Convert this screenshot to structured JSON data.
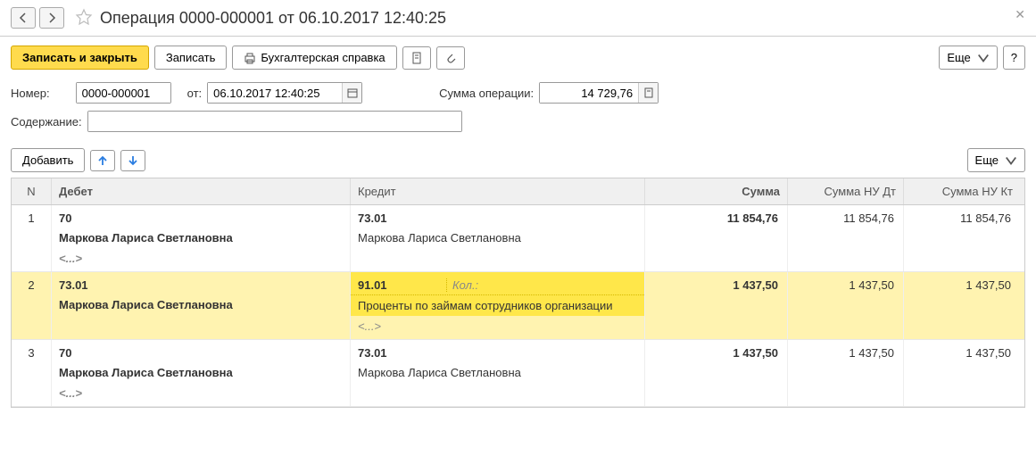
{
  "title": "Операция 0000-000001 от 06.10.2017 12:40:25",
  "toolbar1": {
    "save_close": "Записать и закрыть",
    "save": "Записать",
    "report": "Бухгалтерская справка",
    "more": "Еще",
    "help": "?"
  },
  "form": {
    "number_label": "Номер:",
    "number_value": "0000-000001",
    "date_label": "от:",
    "date_value": "06.10.2017 12:40:25",
    "sum_label": "Сумма операции:",
    "sum_value": "14 729,76",
    "content_label": "Содержание:",
    "content_value": ""
  },
  "toolbar2": {
    "add": "Добавить",
    "more": "Еще"
  },
  "table": {
    "headers": {
      "n": "N",
      "debit": "Дебет",
      "credit": "Кредит",
      "sum": "Сумма",
      "sumdt": "Сумма НУ Дт",
      "sumkt": "Сумма НУ Кт"
    },
    "rows": [
      {
        "n": "1",
        "debit_acc": "70",
        "debit_party": "Маркова Лариса Светлановна",
        "debit_extra": "<...>",
        "credit_acc": "73.01",
        "credit_kol": "",
        "credit_party": "Маркова Лариса Светлановна",
        "credit_extra": "",
        "sum": "11 854,76",
        "sumdt": "11 854,76",
        "sumkt": "11 854,76",
        "selected": false
      },
      {
        "n": "2",
        "debit_acc": "73.01",
        "debit_party": "Маркова Лариса Светлановна",
        "debit_extra": "",
        "credit_acc": "91.01",
        "credit_kol": "Кол.:",
        "credit_party": "Проценты по займам сотрудников организации",
        "credit_extra": "<...>",
        "sum": "1 437,50",
        "sumdt": "1 437,50",
        "sumkt": "1 437,50",
        "selected": true
      },
      {
        "n": "3",
        "debit_acc": "70",
        "debit_party": "Маркова Лариса Светлановна",
        "debit_extra": "<...>",
        "credit_acc": "73.01",
        "credit_kol": "",
        "credit_party": "Маркова Лариса Светлановна",
        "credit_extra": "",
        "sum": "1 437,50",
        "sumdt": "1 437,50",
        "sumkt": "1 437,50",
        "selected": false
      }
    ]
  }
}
